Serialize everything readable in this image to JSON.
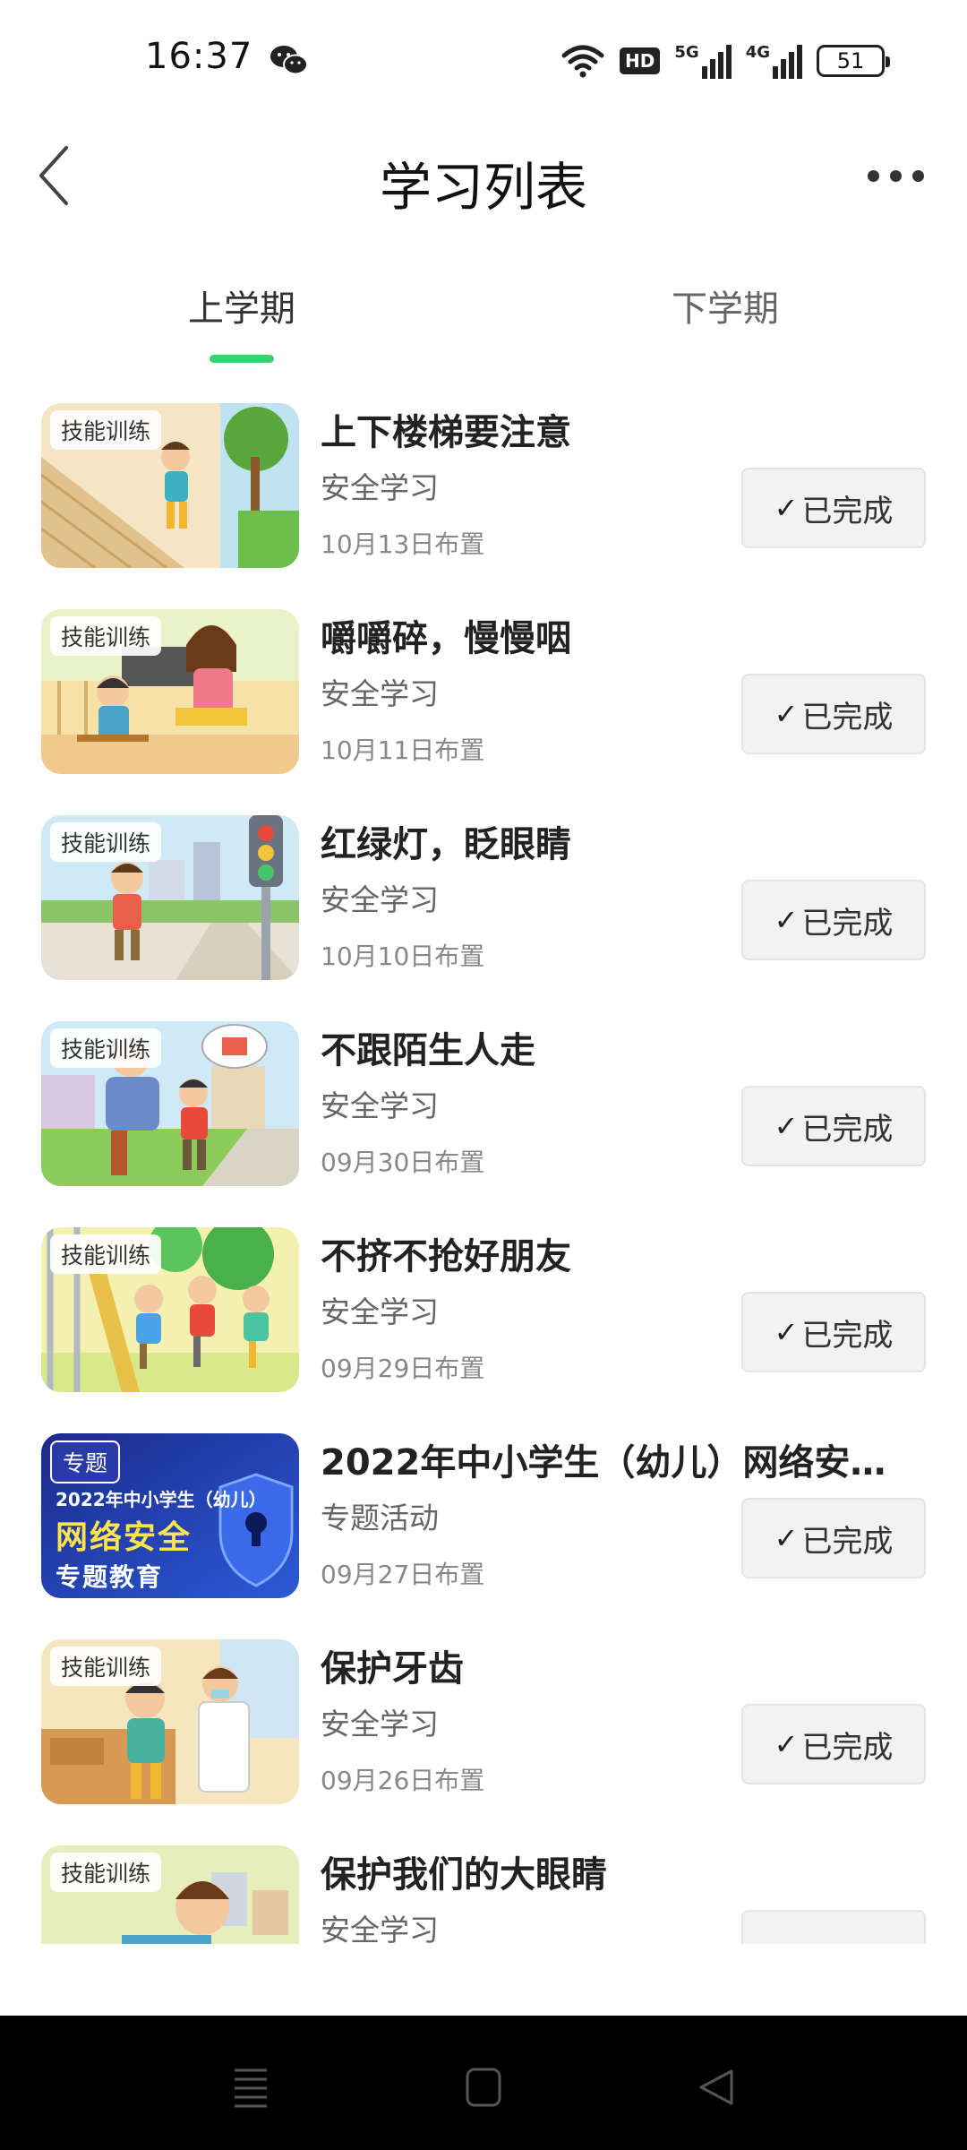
{
  "status_bar": {
    "time": "16:37",
    "network_hd": "HD",
    "signal_5g": "5G",
    "signal_4g": "4G",
    "battery": "51",
    "icons": [
      "wechat-icon",
      "wifi-icon",
      "signal-icon",
      "battery-icon"
    ]
  },
  "header": {
    "title": "学习列表",
    "back_icon": "chevron-left-icon",
    "more_icon": "more-dots-icon"
  },
  "tabs": [
    {
      "label": "上学期",
      "active": true
    },
    {
      "label": "下学期",
      "active": false
    }
  ],
  "colors": {
    "accent": "#3ccf6e",
    "button_bg": "#f2f2f2",
    "nav_bar": "#000000"
  },
  "items": [
    {
      "tag": "技能训练",
      "title": "上下楼梯要注意",
      "category": "安全学习",
      "date": "10月13日布置",
      "status": "已完成"
    },
    {
      "tag": "技能训练",
      "title": "嚼嚼碎，慢慢咽",
      "category": "安全学习",
      "date": "10月11日布置",
      "status": "已完成"
    },
    {
      "tag": "技能训练",
      "title": "红绿灯，眨眼睛",
      "category": "安全学习",
      "date": "10月10日布置",
      "status": "已完成"
    },
    {
      "tag": "技能训练",
      "title": "不跟陌生人走",
      "category": "安全学习",
      "date": "09月30日布置",
      "status": "已完成"
    },
    {
      "tag": "技能训练",
      "title": "不挤不抢好朋友",
      "category": "安全学习",
      "date": "09月29日布置",
      "status": "已完成"
    },
    {
      "tag": "专题",
      "title": "2022年中小学生（幼儿）网络安全...",
      "category": "专题活动",
      "date": "09月27日布置",
      "status": "已完成",
      "thumb_text": {
        "line1": "2022年中小学生（幼儿）",
        "line2": "网络安全",
        "line3": "专题教育"
      }
    },
    {
      "tag": "技能训练",
      "title": "保护牙齿",
      "category": "安全学习",
      "date": "09月26日布置",
      "status": "已完成"
    },
    {
      "tag": "技能训练",
      "title": "保护我们的大眼睛",
      "category": "安全学习",
      "date": "",
      "status": ""
    }
  ],
  "nav_bar": {
    "items": [
      "menu-icon",
      "home-square-icon",
      "back-triangle-icon"
    ]
  }
}
